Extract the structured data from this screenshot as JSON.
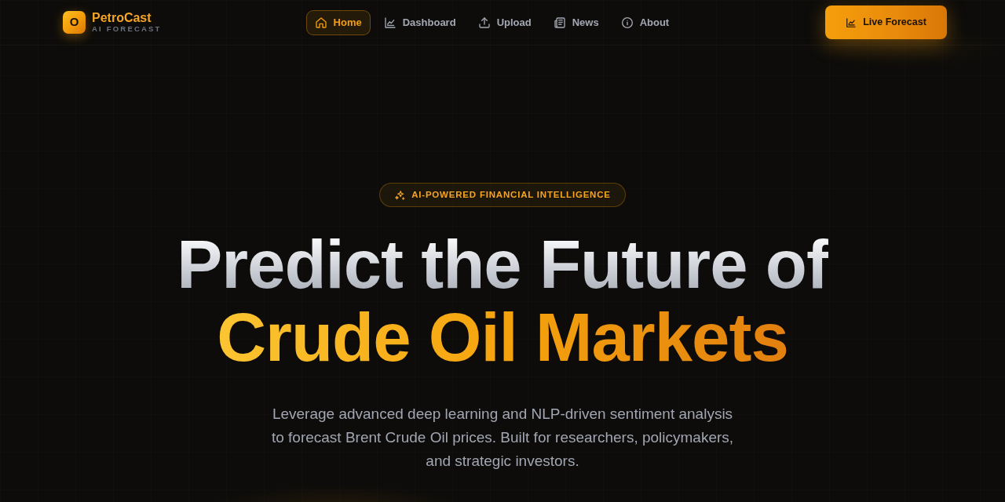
{
  "brand": {
    "logo_letter": "O",
    "name": "PetroCast",
    "tagline": "AI FORECAST"
  },
  "nav": [
    {
      "label": "Home",
      "selected": true
    },
    {
      "label": "Dashboard",
      "selected": false
    },
    {
      "label": "Upload",
      "selected": false
    },
    {
      "label": "News",
      "selected": false
    },
    {
      "label": "About",
      "selected": false
    }
  ],
  "cta_button": {
    "label": "Live Forecast"
  },
  "hero": {
    "badge": "AI-POWERED FINANCIAL INTELLIGENCE",
    "headline_line_1": "Predict the Future of",
    "headline_line_2": "Crude Oil Markets",
    "description": "Leverage advanced deep learning and NLP-driven sentiment analysis to forecast Brent Crude Oil prices. Built for researchers, policymakers, and strategic investors."
  }
}
